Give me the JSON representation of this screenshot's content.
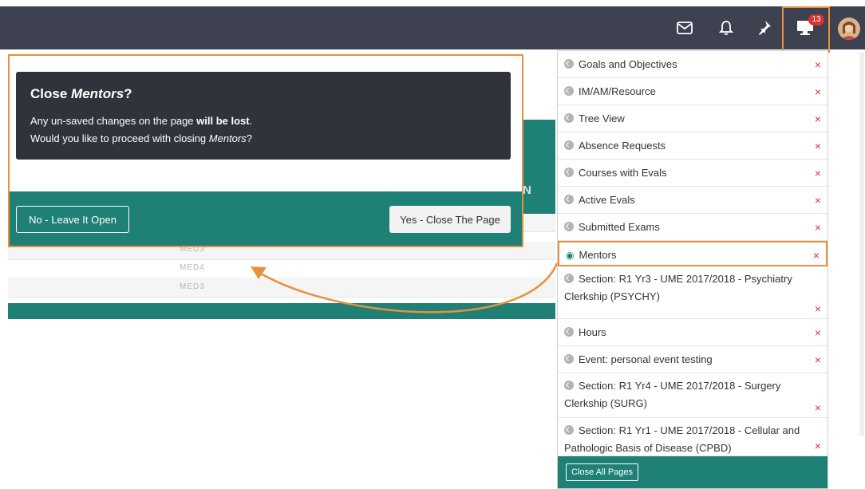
{
  "topbar": {
    "icons": [
      "envelope-icon",
      "bell-icon",
      "pin-icon",
      "monitor-icon"
    ],
    "notification_count": "13",
    "colors": {
      "bar": "#3d4150",
      "badge": "#d9332f",
      "highlight": "#e8913c"
    }
  },
  "background_page": {
    "column_label": "N",
    "rows": [
      "MED3",
      "MED4",
      "MED3"
    ]
  },
  "modal": {
    "title_prefix": "Close ",
    "title_em": "Mentors",
    "title_suffix": "?",
    "line1_prefix": "Any un-saved changes on the page ",
    "line1_bold": "will be lost",
    "line1_suffix": ".",
    "line2_prefix": "Would you like to proceed with closing ",
    "line2_em": "Mentors",
    "line2_suffix": "?",
    "no_button": "No - Leave It Open",
    "yes_button": "Yes - Close The Page",
    "colors": {
      "alert": "#30333c",
      "footer": "#1f8075"
    }
  },
  "open_pages": {
    "items": [
      {
        "label": "Goals and Objectives"
      },
      {
        "label": "IM/AM/Resource"
      },
      {
        "label": "Tree View"
      },
      {
        "label": "Absence Requests"
      },
      {
        "label": "Courses with Evals"
      },
      {
        "label": "Active Evals"
      },
      {
        "label": "Submitted Exams"
      },
      {
        "label": "Mentors",
        "active": true
      },
      {
        "label": "Section: R1 Yr3 - UME 2017/2018 - Psychiatry Clerkship (PSYCHY)"
      },
      {
        "label": "Hours"
      },
      {
        "label": "Event: personal event testing"
      },
      {
        "label": "Section: R1 Yr4 - UME 2017/2018 - Surgery Clerkship (SURG)"
      },
      {
        "label": "Section: R1 Yr1 - UME 2017/2018 - Cellular and Pathologic Basis of Disease (CPBD)"
      }
    ],
    "close_all_button": "Close All Pages",
    "close_icon": "×"
  }
}
